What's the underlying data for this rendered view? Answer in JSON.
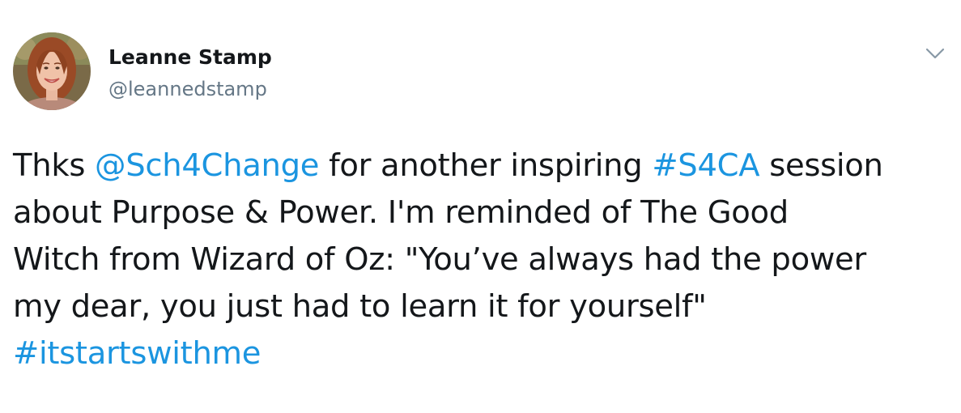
{
  "author": {
    "name": "Leanne Stamp",
    "handle": "@leannedstamp",
    "avatar_icon": "profile-photo"
  },
  "menu": {
    "icon": "chevron-down-icon"
  },
  "tweet": {
    "line1": {
      "t1": "Thks ",
      "mention": "@Sch4Change",
      "t2": " for another inspiring ",
      "hashtag": "#S4CA",
      "t3": " session"
    },
    "line2": "about Purpose & Power. I'm reminded of The Good",
    "line3": "Witch from Wizard of Oz: \"You’ve always had the power",
    "line4": "my dear, you just had to learn it for yourself\"",
    "line5_hashtag": "#itstartswithme"
  },
  "colors": {
    "text": "#14171a",
    "secondary": "#657786",
    "link": "#1b95e0"
  }
}
